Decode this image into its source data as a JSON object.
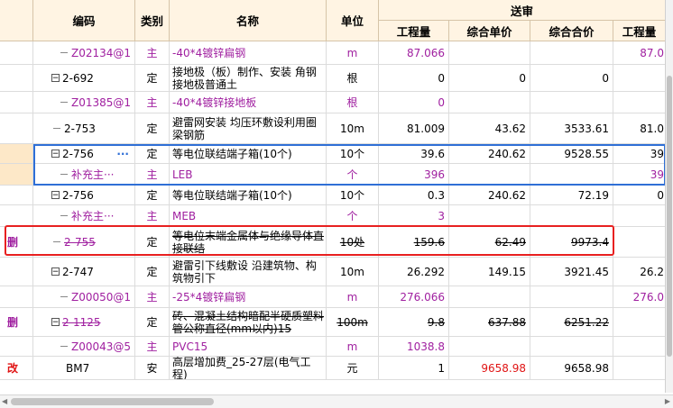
{
  "headers": {
    "code": "编码",
    "category": "类别",
    "name": "名称",
    "unit": "单位",
    "group": "送审",
    "qty": "工程量",
    "unit_price": "综合单价",
    "total": "综合合价",
    "qty2": "工程量"
  },
  "rows": [
    {
      "mark": "",
      "code": "Z02134@1",
      "cat": "主",
      "name": "-40*4镀锌扁钢",
      "unit": "m",
      "qty": "87.066",
      "up": "",
      "total": "",
      "qty2": "87.0",
      "style": "purple",
      "tree": "leaf"
    },
    {
      "mark": "",
      "code": "2-692",
      "cat": "定",
      "name": "接地极（板）制作、安装 角钢接地极普通土",
      "unit": "根",
      "qty": "0",
      "up": "0",
      "total": "0",
      "qty2": "",
      "style": "normal",
      "tree": "minus"
    },
    {
      "mark": "",
      "code": "Z01385@1",
      "cat": "主",
      "name": "-40*4镀锌接地板",
      "unit": "根",
      "qty": "0",
      "up": "",
      "total": "",
      "qty2": "",
      "style": "purple",
      "tree": "leaf"
    },
    {
      "mark": "",
      "code": "2-753",
      "cat": "定",
      "name": "避雷网安装 均压环敷设利用圈梁钢筋",
      "unit": "10m",
      "qty": "81.009",
      "up": "43.62",
      "total": "3533.61",
      "qty2": "81.0",
      "style": "normal",
      "tree": "line"
    },
    {
      "mark": "",
      "code": "2-756",
      "cat": "定",
      "name": "等电位联结端子箱(10个)",
      "unit": "10个",
      "qty": "39.6",
      "up": "240.62",
      "total": "9528.55",
      "qty2": "39",
      "style": "normal",
      "tree": "minus",
      "dots": "···"
    },
    {
      "mark": "",
      "code": "补充主···",
      "cat": "主",
      "name": "LEB",
      "unit": "个",
      "qty": "396",
      "up": "",
      "total": "",
      "qty2": "39",
      "style": "purple",
      "tree": "leaf"
    },
    {
      "mark": "",
      "code": "2-756",
      "cat": "定",
      "name": "等电位联结端子箱(10个)",
      "unit": "10个",
      "qty": "0.3",
      "up": "240.62",
      "total": "72.19",
      "qty2": "0",
      "style": "normal",
      "tree": "minus"
    },
    {
      "mark": "",
      "code": "补充主···",
      "cat": "主",
      "name": "MEB",
      "unit": "个",
      "qty": "3",
      "up": "",
      "total": "",
      "qty2": "",
      "style": "purple",
      "tree": "leaf"
    },
    {
      "mark": "删",
      "code": "2-755",
      "cat": "定",
      "name": "等电位末端金属体与绝缘导体直接联结",
      "unit": "10处",
      "qty": "159.6",
      "up": "62.49",
      "total": "9973.4",
      "qty2": "",
      "style": "deleted",
      "tree": "line"
    },
    {
      "mark": "",
      "code": "2-747",
      "cat": "定",
      "name": "避雷引下线敷设 沿建筑物、构筑物引下",
      "unit": "10m",
      "qty": "26.292",
      "up": "149.15",
      "total": "3921.45",
      "qty2": "26.2",
      "style": "normal",
      "tree": "minus"
    },
    {
      "mark": "",
      "code": "Z00050@1",
      "cat": "主",
      "name": "-25*4镀锌扁钢",
      "unit": "m",
      "qty": "276.066",
      "up": "",
      "total": "",
      "qty2": "276.0",
      "style": "purple",
      "tree": "leaf"
    },
    {
      "mark": "删",
      "code": "2-1125",
      "cat": "定",
      "name": "砖、混凝土结构暗配半硬质塑料管公称直径(mm以内)15",
      "unit": "100m",
      "qty": "9.8",
      "up": "637.88",
      "total": "6251.22",
      "qty2": "",
      "style": "deleted",
      "tree": "minus"
    },
    {
      "mark": "",
      "code": "Z00043@5",
      "cat": "主",
      "name": "PVC15",
      "unit": "m",
      "qty": "1038.8",
      "up": "",
      "total": "",
      "qty2": "",
      "style": "purple",
      "tree": "leaf"
    },
    {
      "mark": "改",
      "code": "BM7",
      "cat": "安",
      "name": "高层增加费_25-27层(电气工程)",
      "unit": "元",
      "qty": "1",
      "up": "9658.98",
      "total": "9658.98",
      "qty2": "",
      "style": "normal",
      "tree": "none",
      "up_red": true
    }
  ],
  "colors": {
    "header_bg": "#fff4e3",
    "purple": "#a020a0",
    "red": "#e01414",
    "highlight_box": "#e82020",
    "selection_box": "#2f6fd6"
  }
}
